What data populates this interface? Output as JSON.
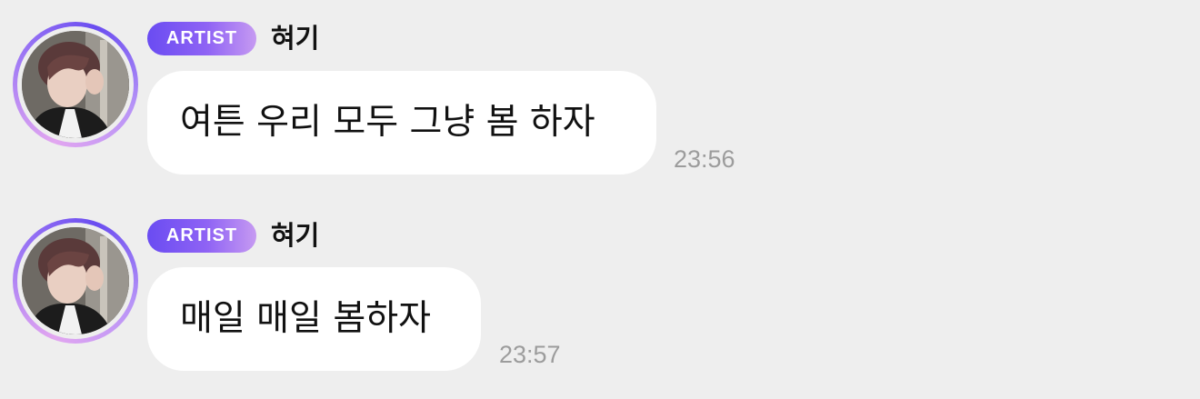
{
  "messages": [
    {
      "badge": "ARTIST",
      "sender": "혀기",
      "text": "여튼 우리 모두 그냥 봄 하자",
      "time": "23:56",
      "avatar_icon": "profile-photo"
    },
    {
      "badge": "ARTIST",
      "sender": "혀기",
      "text": "매일 매일 봄하자",
      "time": "23:57",
      "avatar_icon": "profile-photo"
    }
  ],
  "colors": {
    "background": "#eeeeee",
    "bubble": "#ffffff",
    "badge_start": "#6a4cf2",
    "badge_end": "#c69af2",
    "avatar_ring": "#a37cf5",
    "time": "#9c9c9c"
  }
}
